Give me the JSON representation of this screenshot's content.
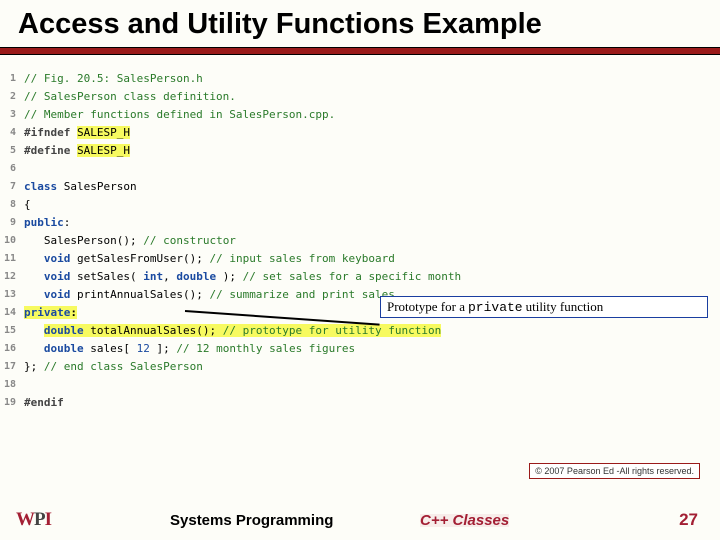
{
  "slide": {
    "title": "Access and Utility Functions Example",
    "callout_prefix": "Prototype for a ",
    "callout_mono": "private",
    "callout_suffix": " utility function",
    "copyright": "© 2007 Pearson Ed -All rights reserved.",
    "footer_left": "Systems Programming",
    "footer_center": "C++ Classes",
    "page_number": "27"
  },
  "code": {
    "lines": [
      {
        "n": "1",
        "html": "<span class='comment'>// Fig. 20.5: SalesPerson.h</span>"
      },
      {
        "n": "2",
        "html": "<span class='comment'>// SalesPerson class definition.</span>"
      },
      {
        "n": "3",
        "html": "<span class='comment'>// Member functions defined in SalesPerson.cpp.</span>"
      },
      {
        "n": "4",
        "html": "<span class='pp'>#ifndef</span> <span class='hl'>SALESP_H</span>"
      },
      {
        "n": "5",
        "html": "<span class='pp'>#define</span> <span class='hl'>SALESP_H</span>"
      },
      {
        "n": "6",
        "html": ""
      },
      {
        "n": "7",
        "html": "<span class='kw'>class</span> SalesPerson"
      },
      {
        "n": "8",
        "html": "{"
      },
      {
        "n": "9",
        "html": "<span class='kw'>public</span>:"
      },
      {
        "n": "10",
        "html": "   SalesPerson(); <span class='comment'>// constructor</span>"
      },
      {
        "n": "11",
        "html": "   <span class='kw'>void</span> getSalesFromUser(); <span class='comment'>// input sales from keyboard</span>"
      },
      {
        "n": "12",
        "html": "   <span class='kw'>void</span> setSales( <span class='kw'>int</span>, <span class='kw'>double</span> ); <span class='comment'>// set sales for a specific month</span>"
      },
      {
        "n": "13",
        "html": "   <span class='kw'>void</span> printAnnualSales(); <span class='comment'>// summarize and print sales</span>"
      },
      {
        "n": "14",
        "html": "<span class='hl-priv'><span class='kw'>private</span>:</span>"
      },
      {
        "n": "15",
        "html": "   <span class='hl'><span class='kw'>double</span> totalAnnualSales(); <span class='comment'>// prototype for utility function</span></span>"
      },
      {
        "n": "16",
        "html": "   <span class='kw'>double</span> sales[ <span class='num'>12</span> ]; <span class='comment'>// 12 monthly sales figures</span>"
      },
      {
        "n": "17",
        "html": "}; <span class='comment'>// end class SalesPerson</span>"
      },
      {
        "n": "18",
        "html": ""
      },
      {
        "n": "19",
        "html": "<span class='pp'>#endif</span>"
      }
    ]
  }
}
